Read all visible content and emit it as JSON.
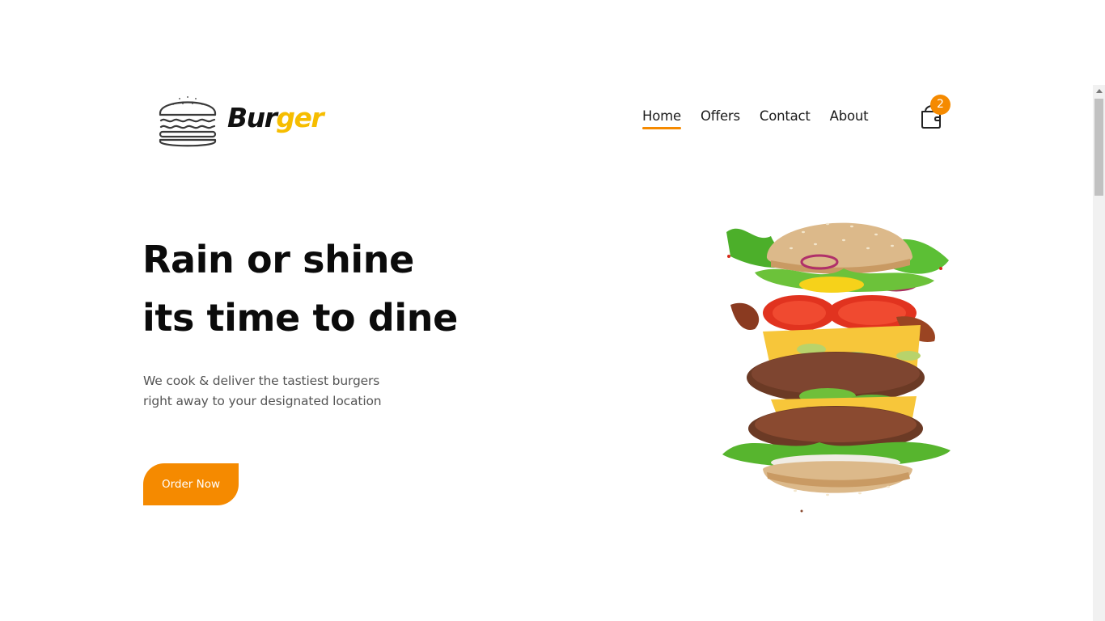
{
  "brand": {
    "name_part1": "Bur",
    "name_part2": "ger",
    "logo_icon": "burger-outline-icon",
    "accent_color": "#f6bd00"
  },
  "nav": {
    "items": [
      {
        "label": "Home",
        "active": true
      },
      {
        "label": "Offers",
        "active": false
      },
      {
        "label": "Contact",
        "active": false
      },
      {
        "label": "About",
        "active": false
      }
    ],
    "active_underline_color": "#f58a00"
  },
  "cart": {
    "icon": "shopping-bag-icon",
    "count": "2",
    "badge_color": "#f58a00"
  },
  "hero": {
    "title_line1": "Rain or shine",
    "title_line2": "its time to dine",
    "subtitle_line1": "We cook & deliver the tastiest burgers",
    "subtitle_line2": "right away to your designated location",
    "cta_label": "Order Now",
    "cta_color": "#f58a00",
    "image_subject": "exploded-burger-illustration"
  }
}
